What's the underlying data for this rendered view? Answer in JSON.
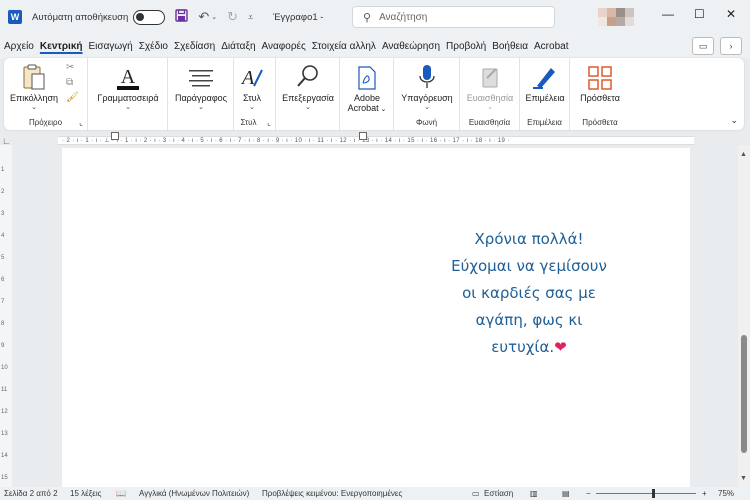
{
  "titlebar": {
    "autosave_label": "Αυτόματη αποθήκευση",
    "doc_title": "Έγγραφο1  -",
    "search_placeholder": "Αναζήτηση",
    "logo_letter": "W"
  },
  "menu": {
    "items": [
      "Αρχείο",
      "Κεντρική",
      "Εισαγωγή",
      "Σχέδιο",
      "Σχεδίαση",
      "Διάταξη",
      "Αναφορές",
      "Στοιχεία αλληλ",
      "Αναθεώρηση",
      "Προβολή",
      "Βοήθεια",
      "Acrobat"
    ],
    "active": "Κεντρική"
  },
  "ribbon": {
    "clipboard": {
      "paste": "Επικόλληση",
      "group": "Πρόχειρο"
    },
    "font": {
      "label": "Γραμματοσειρά"
    },
    "paragraph": {
      "label": "Παράγραφος"
    },
    "styles": {
      "label": "Στυλ",
      "group": "Στυλ"
    },
    "editing": {
      "label": "Επεξεργασία"
    },
    "acrobat": {
      "line1": "Adobe",
      "line2": "Acrobat"
    },
    "voice": {
      "label": "Υπαγόρευση",
      "group": "Φωνή"
    },
    "sensitivity": {
      "label": "Ευαισθησία",
      "group": "Ευαισθησία"
    },
    "editor": {
      "label": "Επιμέλεια",
      "group": "Επιμέλεια"
    },
    "addins": {
      "label": "Πρόσθετα",
      "group": "Πρόσθετα"
    }
  },
  "ruler": {
    "text": "· 2 · ı · 1 · ı · ⊥ · ı · 1 · ı · 2 · ı · 3 · ı · 4 · ı · 5 · ı · 6 · ı · 7 · ı · 8 · ı · 9 · ı · 10 · ı · 11 · ı · 12 · ı · 13 · ı · 14 · ı · 15 · ı · 16 · ı · 17 · ı · 18 · ı · 19 ·"
  },
  "vruler": {
    "numbers": [
      "1",
      "2",
      "3",
      "4",
      "5",
      "6",
      "7",
      "8",
      "9",
      "10",
      "11",
      "12",
      "13",
      "14",
      "15"
    ]
  },
  "document": {
    "lines": [
      "Χρόνια πολλά!",
      "Εύχομαι να γεμίσουν",
      "οι καρδιές σας με",
      "αγάπη, φως κι"
    ],
    "last_line_text": "ευτυχία.",
    "emoji": "❤"
  },
  "status": {
    "page": "Σελίδα 2 από 2",
    "words": "15 λέξεις",
    "language": "Αγγλικά (Ηνωμένων Πολιτειών)",
    "predictions": "Προβλέψεις κειμένου: Ενεργοποιημένες",
    "focus": "Εστίαση",
    "zoom": "75%"
  },
  "colors": {
    "accent": "#185abd",
    "text_blue": "#1f5f95",
    "heart": "#e0245e"
  }
}
